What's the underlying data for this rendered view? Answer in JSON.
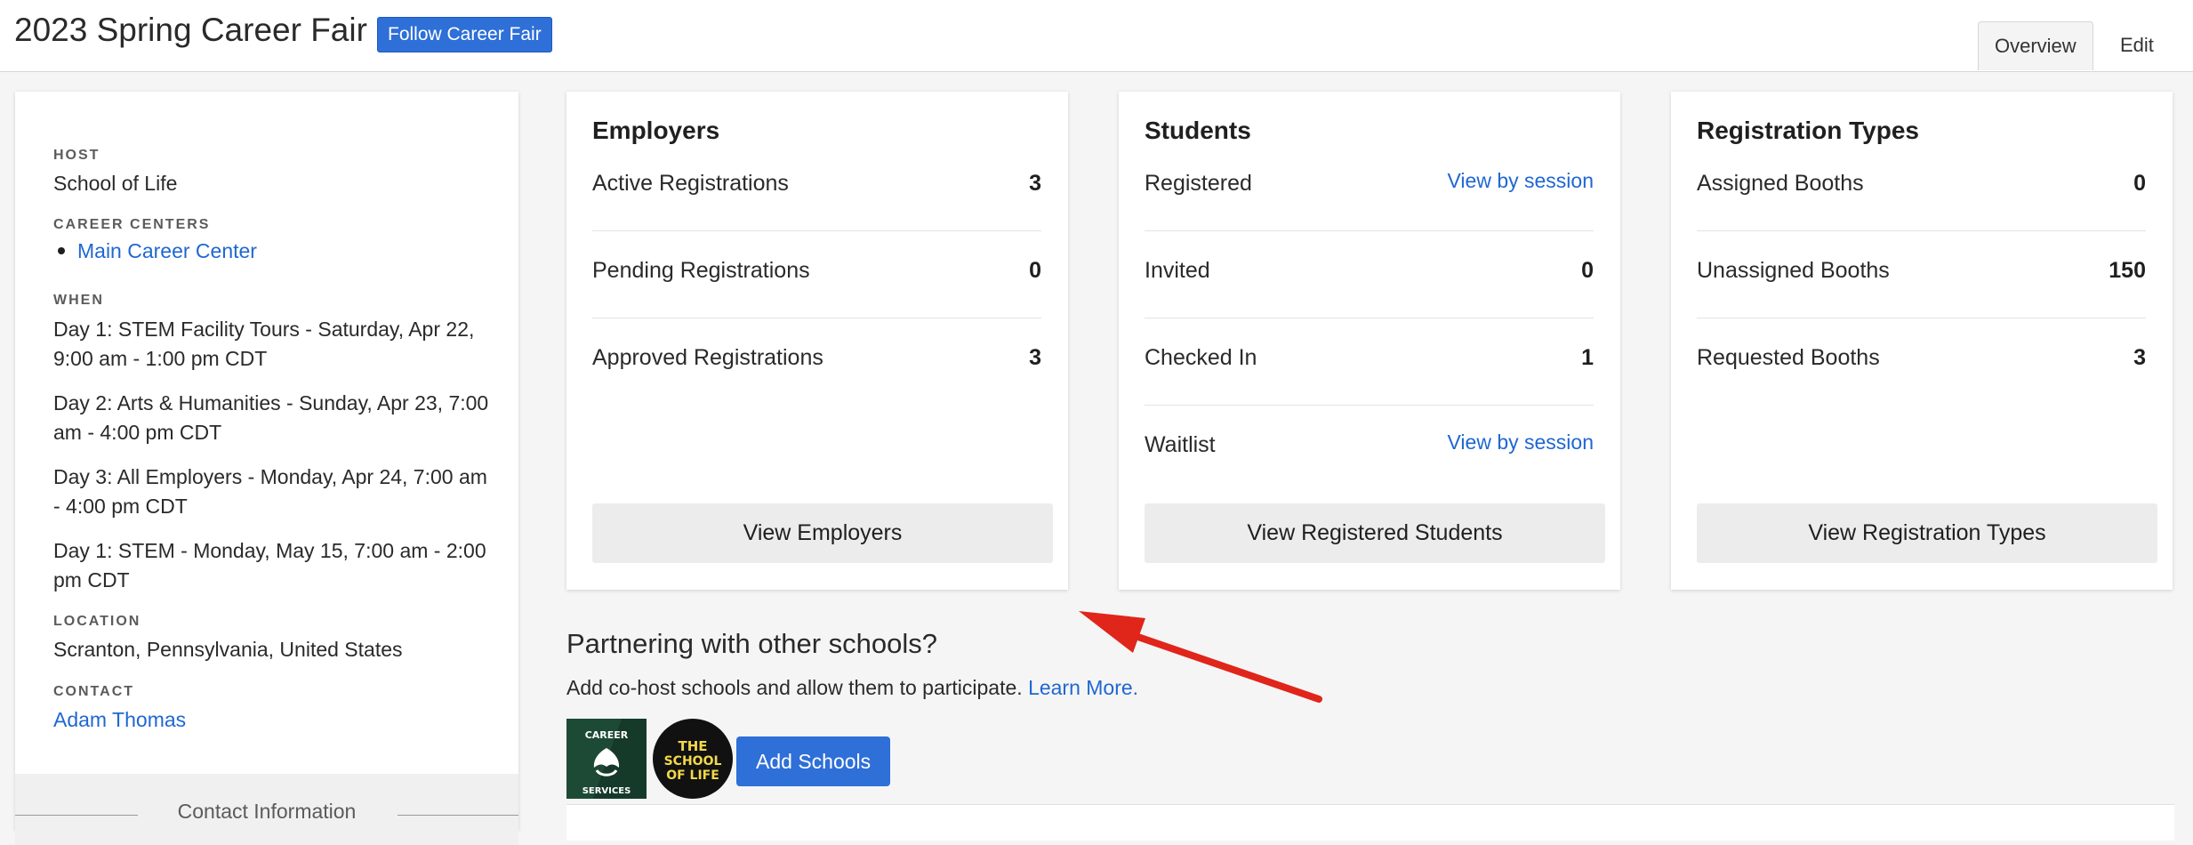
{
  "header": {
    "title": "2023 Spring Career Fair",
    "follow_label": "Follow Career Fair",
    "tabs": [
      {
        "label": "Overview"
      },
      {
        "label": "Edit"
      }
    ]
  },
  "sidebar": {
    "host_label": "HOST",
    "host": "School of Life",
    "career_centers_label": "CAREER CENTERS",
    "career_centers": [
      "Main Career Center"
    ],
    "when_label": "WHEN",
    "days": [
      "Day 1: STEM Facility Tours - Saturday, Apr 22, 9:00 am - 1:00 pm CDT",
      "Day 2: Arts & Humanities - Sunday, Apr 23, 7:00 am - 4:00 pm CDT",
      "Day 3: All Employers - Monday, Apr 24, 7:00 am - 4:00 pm CDT",
      "Day 1: STEM - Monday, May 15, 7:00 am - 2:00 pm CDT"
    ],
    "location_label": "LOCATION",
    "location": "Scranton, Pennsylvania, United States",
    "contact_label": "CONTACT",
    "contact": "Adam Thomas",
    "contact_info_label": "Contact Information"
  },
  "cards": {
    "employers": {
      "title": "Employers",
      "rows": [
        {
          "label": "Active Registrations",
          "value": "3"
        },
        {
          "label": "Pending Registrations",
          "value": "0"
        },
        {
          "label": "Approved Registrations",
          "value": "3"
        }
      ],
      "button": "View Employers"
    },
    "students": {
      "title": "Students",
      "rows": [
        {
          "label": "Registered",
          "link": "View by session"
        },
        {
          "label": "Invited",
          "value": "0"
        },
        {
          "label": "Checked In",
          "value": "1"
        },
        {
          "label": "Waitlist",
          "link": "View by session"
        }
      ],
      "button": "View Registered Students"
    },
    "registration_types": {
      "title": "Registration Types",
      "rows": [
        {
          "label": "Assigned Booths",
          "value": "0"
        },
        {
          "label": "Unassigned Booths",
          "value": "150"
        },
        {
          "label": "Requested Booths",
          "value": "3"
        }
      ],
      "button": "View Registration Types"
    }
  },
  "partnering": {
    "title": "Partnering with other schools?",
    "description": "Add co-host schools and allow them to participate.",
    "learn_more": "Learn More.",
    "add_button": "Add Schools",
    "logo1_text": [
      "CAREER",
      "SERVICES"
    ],
    "logo2_text": [
      "THE",
      "SCHOOL",
      "OF LIFE"
    ]
  },
  "colors": {
    "primary": "#2e6fd8",
    "link": "#1f67d2",
    "annotation": "#e0251b"
  }
}
